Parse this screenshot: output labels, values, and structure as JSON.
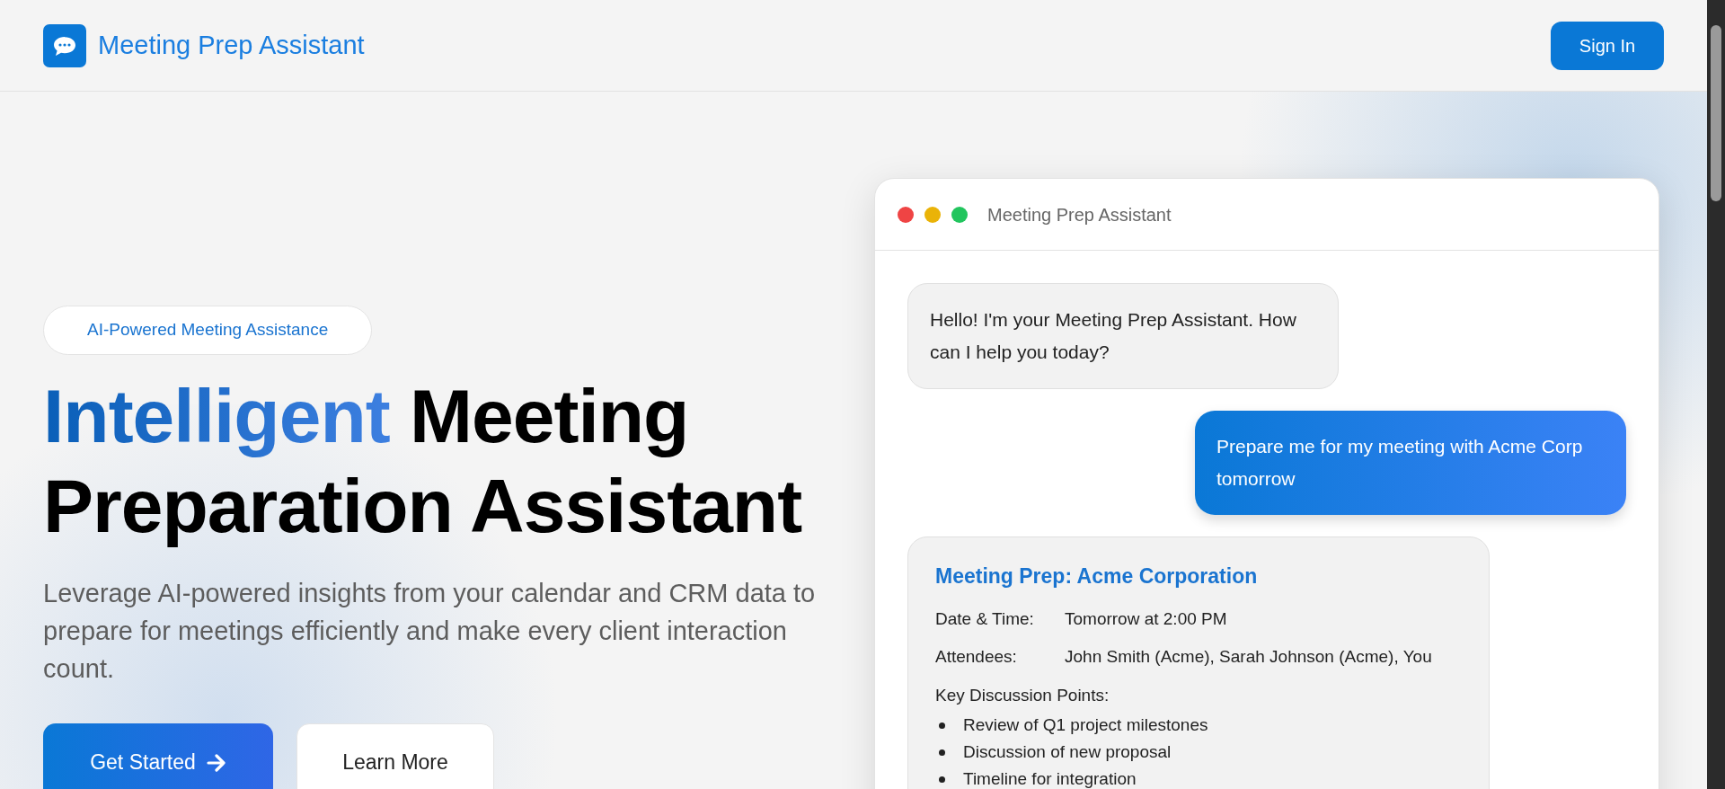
{
  "header": {
    "brand": "Meeting Prep Assistant",
    "sign_in": "Sign In"
  },
  "hero": {
    "badge": "AI-Powered Meeting Assistance",
    "headline_accent": "Intelligent",
    "headline_rest": "Meeting Preparation Assistant",
    "description": "Leverage AI-powered insights from your calendar and CRM data to prepare for meetings efficiently and make every client interaction count.",
    "buttons": [
      {
        "label": "Get Started",
        "kind": "primary"
      },
      {
        "label": "Learn More",
        "kind": "secondary"
      }
    ]
  },
  "chat_window": {
    "title": "Meeting Prep Assistant",
    "messages": [
      {
        "kind": "assistant",
        "text": "Hello! I'm your Meeting Prep Assistant. How can I help you today?"
      },
      {
        "kind": "user",
        "text": "Prepare me for my meeting with Acme Corp tomorrow"
      },
      {
        "kind": "card",
        "title": "Meeting Prep: Acme Corporation",
        "fields": [
          {
            "label": "Date & Time:",
            "value": "Tomorrow at 2:00 PM"
          },
          {
            "label": "Attendees:",
            "value": "John Smith (Acme), Sarah Johnson (Acme), You"
          }
        ],
        "list_title": "Key Discussion Points:",
        "points": [
          "Review of Q1 project milestones",
          "Discussion of new proposal",
          "Timeline for integration"
        ]
      }
    ]
  }
}
